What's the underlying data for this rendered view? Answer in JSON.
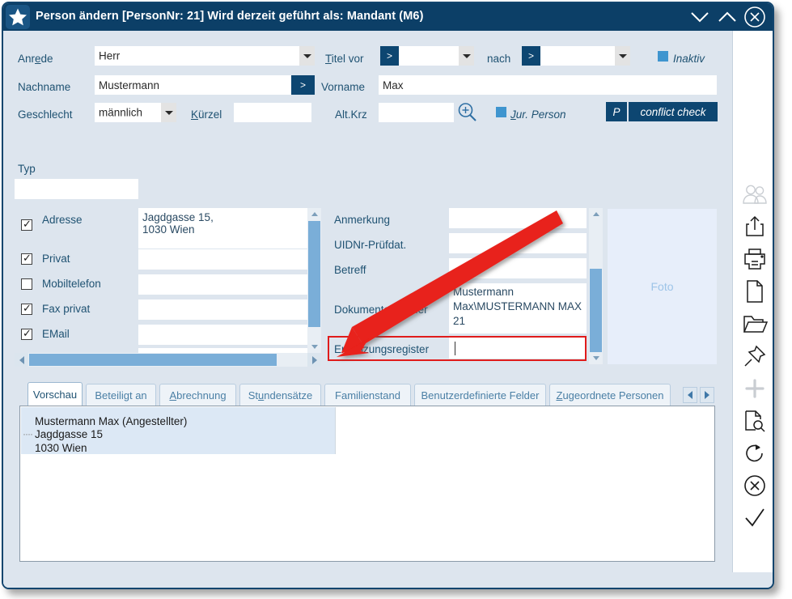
{
  "window": {
    "title": "Person ändern  [PersonNr: 21] Wird derzeit geführt als: Mandant (M6)",
    "star_icon": "star-icon",
    "buttons": [
      {
        "name": "chevron-down-icon",
        "label": "⌄"
      },
      {
        "name": "chevron-up-icon",
        "label": "⌃"
      },
      {
        "name": "close-icon",
        "label": "✕"
      }
    ]
  },
  "colors": {
    "titlebar": "#0c3f67",
    "accent_dark_blue": "#0d4671",
    "label_blue": "#1f5272",
    "form_background": "#dde5ee",
    "checkbox_blue": "#3f95cf",
    "scroll_thumb": "#7aaed8",
    "highlight_red": "#e01b1b",
    "foto_placeholder": "#e7eefa"
  },
  "form": {
    "anrede": {
      "label": "Anrede",
      "mnemonic": "e",
      "value": "Herr"
    },
    "titel_vor": {
      "label": "Titel vor",
      "mnemonic": "T",
      "button": ">",
      "value": ""
    },
    "nach": {
      "label": "nach",
      "button": ">",
      "value": ""
    },
    "inaktiv": {
      "label": "Inaktiv",
      "checked": true
    },
    "nachname": {
      "label": "Nachname",
      "value": "Mustermann",
      "button": ">"
    },
    "vorname": {
      "label": "Vorname",
      "value": "Max"
    },
    "geschlecht": {
      "label": "Geschlecht",
      "value": "männlich"
    },
    "kuerzel": {
      "label": "Kürzel",
      "mnemonic": "K",
      "value": ""
    },
    "alt_krz": {
      "label": "Alt.Krz",
      "value": "",
      "search_icon": "magnifier-plus-icon"
    },
    "jur_person": {
      "label": "Jur. Person",
      "mnemonic": "J",
      "checked": true
    },
    "p_button": {
      "label": "P"
    },
    "conflict_check_button": {
      "label": "conflict check"
    },
    "typ": {
      "label": "Typ",
      "value": ""
    }
  },
  "contact_list": {
    "rows": [
      {
        "label": "Adresse",
        "checked": true,
        "value": "Jagdgasse 15,\n1030 Wien"
      },
      {
        "label": "Privat",
        "checked": true,
        "value": ""
      },
      {
        "label": "Mobiltelefon",
        "checked": false,
        "value": ""
      },
      {
        "label": "Fax privat",
        "checked": true,
        "value": ""
      },
      {
        "label": "EMail",
        "checked": true,
        "value": ""
      }
    ]
  },
  "detail_panel": {
    "rows": [
      {
        "label": "Anmerkung",
        "value": ""
      },
      {
        "label": "UIDNr-Prüfdat.",
        "value": ""
      },
      {
        "label": "Betreff",
        "value": ""
      },
      {
        "label": "Dokumentenordner",
        "value": "Mustermann Max\\MUSTERMANN MAX 21"
      },
      {
        "label": "Ergänzungsregister",
        "value": "",
        "highlighted": true,
        "focused": true
      }
    ]
  },
  "foto": {
    "label": "Foto"
  },
  "tabs": {
    "items": [
      {
        "label": "Vorschau",
        "active": true
      },
      {
        "label": "Beteiligt an",
        "active": false
      },
      {
        "label": "Abrechnung",
        "mnemonic": "A",
        "active": false
      },
      {
        "label": "Stundensätze",
        "mnemonic": "u",
        "active": false
      },
      {
        "label": "Familienstand",
        "active": false
      },
      {
        "label": "Benutzerdefinierte Felder",
        "active": false
      },
      {
        "label": "Zugeordnete Personen",
        "mnemonic": "Z",
        "active": false
      }
    ],
    "nav_prev": "◀",
    "nav_next": "▶"
  },
  "preview": {
    "lines": [
      "Mustermann Max (Angestellter)",
      "Jagdgasse 15",
      "1030 Wien"
    ]
  },
  "sidebar": {
    "items": [
      {
        "name": "persons-icon",
        "label": "Personen",
        "disabled": true
      },
      {
        "name": "share-export-icon",
        "label": "Exportieren",
        "disabled": false
      },
      {
        "name": "print-icon",
        "label": "Drucken",
        "disabled": false
      },
      {
        "name": "document-icon",
        "label": "Dokument",
        "disabled": false
      },
      {
        "name": "folder-icon",
        "label": "Ordner",
        "disabled": false
      },
      {
        "name": "pin-icon",
        "label": "Anheften",
        "disabled": false
      },
      {
        "name": "plus-icon",
        "label": "Neu",
        "disabled": true
      },
      {
        "name": "document-search-icon",
        "label": "Dokument suchen",
        "disabled": false
      },
      {
        "name": "refresh-icon",
        "label": "Aktualisieren",
        "disabled": false
      },
      {
        "name": "cancel-circle-icon",
        "label": "Abbrechen",
        "disabled": false
      },
      {
        "name": "confirm-check-icon",
        "label": "Bestätigen",
        "disabled": false
      }
    ]
  },
  "annotation": {
    "arrow_color": "#e01b1b",
    "points_to": "Ergänzungsregister"
  }
}
